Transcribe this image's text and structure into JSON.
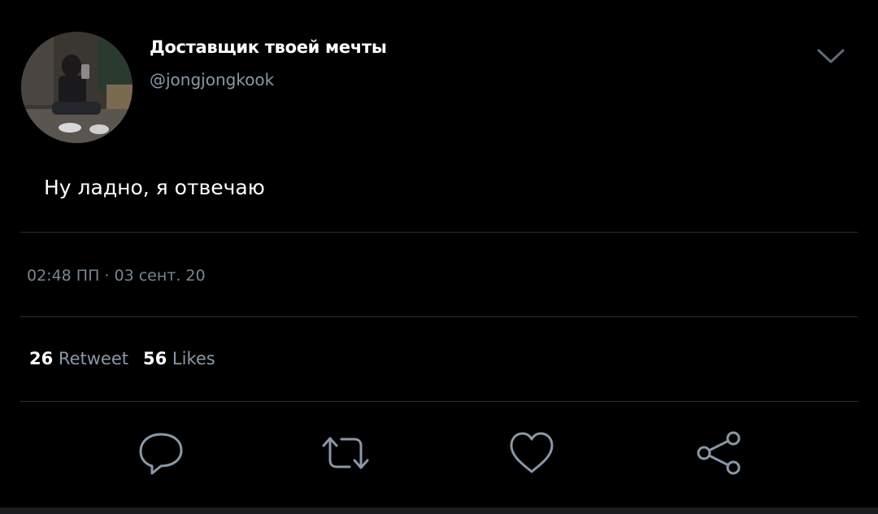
{
  "author": {
    "display_name": "Доставщик твоей мечты",
    "handle": "@jongjongkook"
  },
  "tweet": {
    "text": "Ну ладно, я отвечаю",
    "timestamp": "02:48 ПП · 03 сент. 20"
  },
  "stats": {
    "retweets": "26",
    "retweets_label": "Retweet",
    "likes": "56",
    "likes_label": "Likes"
  },
  "actions": [
    {
      "icon": "reply-icon"
    },
    {
      "icon": "retweet-icon"
    },
    {
      "icon": "like-icon"
    },
    {
      "icon": "share-icon"
    }
  ],
  "colors": {
    "background": "#000000",
    "text_primary": "#ffffff",
    "text_secondary": "#8a98a6",
    "divider": "#2b2f33",
    "icon": "#8a98a6"
  }
}
